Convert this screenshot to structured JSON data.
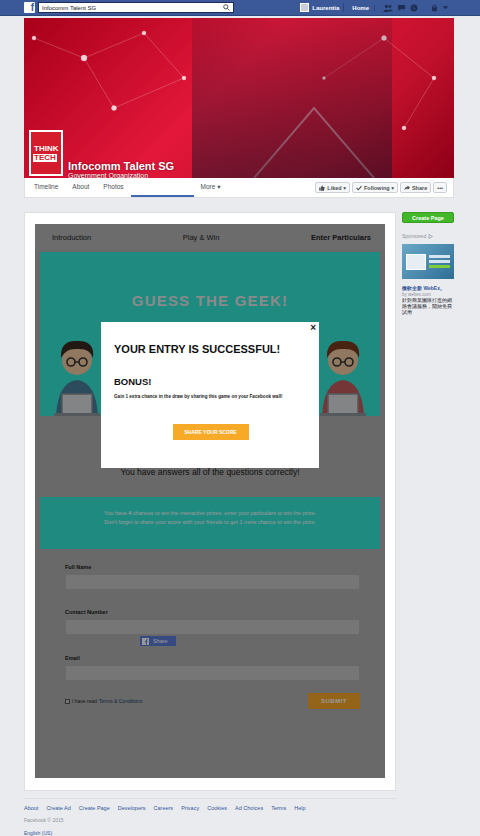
{
  "topbar": {
    "logo": "f",
    "search": "Infocomm Talent SG",
    "user": "Laurentia",
    "home": "Home"
  },
  "cover": {
    "page_name": "Infocomm Talent SG",
    "category": "Government Organization",
    "logo_lines": [
      "THINK",
      "TECH"
    ]
  },
  "page_tabs": [
    {
      "label": "Timeline",
      "selected": false
    },
    {
      "label": "About",
      "selected": false
    },
    {
      "label": "Photos",
      "selected": false
    },
    {
      "label": "",
      "selected": true
    },
    {
      "label": "More ▾",
      "selected": false
    }
  ],
  "page_actions": [
    {
      "label": "Liked ▾",
      "kind": "like"
    },
    {
      "label": "Following ▾",
      "kind": "follow"
    },
    {
      "label": "Share",
      "kind": "share"
    },
    {
      "label": "•••",
      "kind": "more"
    }
  ],
  "app": {
    "tabs": [
      {
        "label": "Introduction",
        "selected": false
      },
      {
        "label": "Play & Win",
        "selected": false
      },
      {
        "label": "Enter Particulars",
        "selected": true
      }
    ],
    "title": "GUESS THE GEEK!",
    "result": "You have answers all of the questions correctly!",
    "info": {
      "before": "You have ",
      "count": "4",
      "after": " chances to win the interactive prizes, enter your particulars to win the prize.",
      "line2": "Don't forget to share your score with your friends to get 1 more chance to win the prize."
    },
    "form": {
      "fields": [
        {
          "label": "Full Name",
          "share_button": false
        },
        {
          "label": "Contact Number",
          "share_button": true
        },
        {
          "label": "Email",
          "share_button": false
        }
      ],
      "share": "Share",
      "terms": {
        "checked": false,
        "text": "I have read ",
        "link": "Terms & Conditions"
      },
      "submit": "SUBMIT"
    }
  },
  "modal": {
    "close": "×",
    "title": "YOUR ENTRY IS SUCCESSFUL!",
    "bonus": "BONUS!",
    "text": "Gain 1 extra chance in the draw by sharing this game on your Facebook wall!",
    "button": "SHARE YOUR SCORE"
  },
  "sidebar": {
    "create_page": "Create Page",
    "sponsored": "Sponsored",
    "ad": {
      "title": "微軟全新 WebEx。",
      "source": "by webex.com",
      "body": "針對商業團隊打造的網路會議服務，開始免費試用"
    }
  },
  "footer": {
    "links": [
      "About",
      "Create Ad",
      "Create Page",
      "Developers",
      "Careers",
      "Privacy",
      "Cookies",
      "Ad Choices",
      "Terms",
      "Help"
    ],
    "copyright": "Facebook © 2015",
    "language": "English (US)"
  }
}
